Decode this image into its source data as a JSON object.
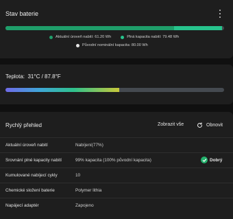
{
  "battery_status": {
    "title": "Stav baterie",
    "current_charge_pct": 77,
    "full_capacity_pct": 99,
    "legend": [
      {
        "label": "Aktuální úroveň nabití:",
        "value": "61.20 Wh",
        "color": "#1f9e6a"
      },
      {
        "label": "Plná kapacita nabití:",
        "value": "79.48 Wh",
        "color": "#27c38c"
      },
      {
        "label": "Původní nominální kapacita:",
        "value": "80.00 Wh",
        "color": "#e6e6e6"
      }
    ]
  },
  "temperature": {
    "label": "Teplota:",
    "value": "31°C / 87.8°F",
    "level_pct": 52
  },
  "quick_overview": {
    "title": "Rychlý přehled",
    "show_all_label": "Zobrazit vše",
    "refresh_label": "Obnovit",
    "rows": [
      {
        "label": "Aktuální úroveň nabití",
        "value": "Nabíjení(77%)"
      },
      {
        "label": "Srovnání plné kapacity nabití",
        "value": "99% kapacita (100% původní kapacita)",
        "badge": "Dobrý"
      },
      {
        "label": "Kumulované nabíjecí cykly",
        "value": "10"
      },
      {
        "label": "Chemické složení baterie",
        "value": "Polymer lithia"
      },
      {
        "label": "Napájecí adaptér",
        "value": "Zapojeno"
      }
    ]
  },
  "colors": {
    "charge_fill": "#1f9e6a",
    "capacity_fill": "#27c38c",
    "good_badge": "#23b26d"
  }
}
